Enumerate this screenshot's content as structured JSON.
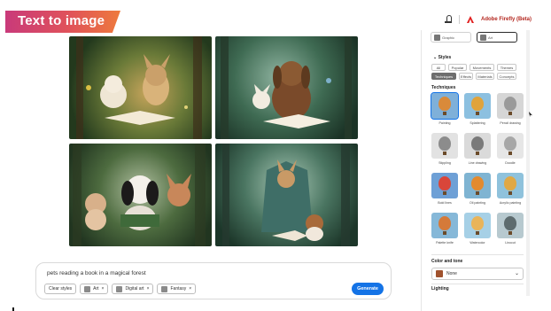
{
  "header": {
    "banner_title": "Text to image",
    "brand": "Adobe Firefly (Beta)",
    "icons": [
      "bell-icon",
      "adobe-logo-icon"
    ]
  },
  "gallery": {
    "images": [
      {
        "alt_icon": "image-1"
      },
      {
        "alt_icon": "image-2"
      },
      {
        "alt_icon": "image-3"
      },
      {
        "alt_icon": "image-4"
      }
    ]
  },
  "prompt": {
    "text": "pets reading a book in a magical forest",
    "chips": [
      {
        "label": "Clear styles"
      },
      {
        "label": "Art"
      },
      {
        "label": "Digital art"
      },
      {
        "label": "Fantasy"
      }
    ],
    "generate_label": "Generate"
  },
  "panel": {
    "top_cards": [
      {
        "label": "Graphic"
      },
      {
        "label": "Art"
      }
    ],
    "styles_title": "Styles",
    "tabs": [
      {
        "label": "All"
      },
      {
        "label": "Popular"
      },
      {
        "label": "Movements"
      },
      {
        "label": "Themes"
      },
      {
        "label": "Techniques"
      },
      {
        "label": "Effects"
      },
      {
        "label": "Materials"
      },
      {
        "label": "Concepts"
      }
    ],
    "active_tab": "Techniques",
    "techniques_title": "Techniques",
    "techniques": [
      {
        "label": "Painting",
        "color": "#d98a3a"
      },
      {
        "label": "Splattering",
        "color": "#e0a33c"
      },
      {
        "label": "Pencil drawing",
        "color": "#9a9a9a"
      },
      {
        "label": "Stippling",
        "color": "#8c8c8c"
      },
      {
        "label": "Line drawing",
        "color": "#7a7a7a"
      },
      {
        "label": "Doodle",
        "color": "#a7a7a7"
      },
      {
        "label": "Bold lines",
        "color": "#d9463a"
      },
      {
        "label": "Oil painting",
        "color": "#e38a2e"
      },
      {
        "label": "Acrylic painting",
        "color": "#e0a845"
      },
      {
        "label": "Palette knife",
        "color": "#d57a3a"
      },
      {
        "label": "Watercolor",
        "color": "#e9b45a"
      },
      {
        "label": "Linocut",
        "color": "#5d6b6e"
      }
    ],
    "color_tone_title": "Color and tone",
    "color_tone_value": "None",
    "lighting_title": "Lighting"
  },
  "colors": {
    "accent": "#1473e6",
    "banner_start": "#c93a7a",
    "banner_end": "#ee7a3c"
  }
}
